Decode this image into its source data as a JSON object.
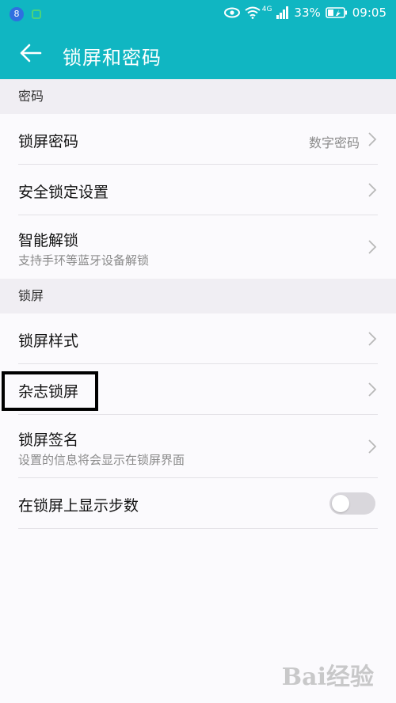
{
  "status_bar": {
    "network": "4G",
    "battery": "33%",
    "time": "09:05"
  },
  "header": {
    "title": "锁屏和密码"
  },
  "sections": [
    {
      "title": "密码",
      "items": [
        {
          "label": "锁屏密码",
          "value": "数字密码"
        },
        {
          "label": "安全锁定设置"
        },
        {
          "label": "智能解锁",
          "subtitle": "支持手环等蓝牙设备解锁"
        }
      ]
    },
    {
      "title": "锁屏",
      "items": [
        {
          "label": "锁屏样式"
        },
        {
          "label": "杂志锁屏"
        },
        {
          "label": "锁屏签名",
          "subtitle": "设置的信息将会显示在锁屏界面"
        },
        {
          "label": "在锁屏上显示步数",
          "toggle": false
        }
      ]
    }
  ],
  "watermark": "Bai经验",
  "colors": {
    "header": "#10b6c2",
    "section_bg": "#f0eef3",
    "background": "#fbfafd"
  }
}
